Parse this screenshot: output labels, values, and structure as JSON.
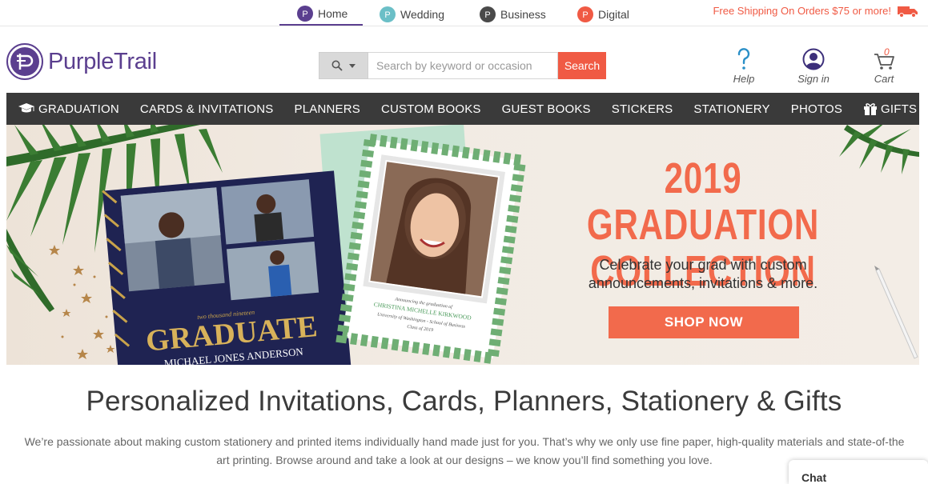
{
  "site_tabs": [
    {
      "label": "Home",
      "color": "#5b3f8f",
      "active": true
    },
    {
      "label": "Wedding",
      "color": "#6bbfc7",
      "active": false
    },
    {
      "label": "Business",
      "color": "#4a4a4a",
      "active": false
    },
    {
      "label": "Digital",
      "color": "#f05a44",
      "active": false
    }
  ],
  "shipping_text": "Free Shipping On Orders $75 or more!",
  "brand": {
    "name": "PurpleTrail",
    "color": "#5b3f8f",
    "accent": "#f05a44"
  },
  "search": {
    "placeholder": "Search by keyword or occasion",
    "value": "",
    "button_label": "Search"
  },
  "header_tools": {
    "help_label": "Help",
    "signin_label": "Sign in",
    "cart_label": "Cart",
    "cart_count": "0"
  },
  "categories": [
    {
      "label": "GRADUATION",
      "icon": "graduation-cap-icon"
    },
    {
      "label": "CARDS & INVITATIONS"
    },
    {
      "label": "PLANNERS"
    },
    {
      "label": "CUSTOM BOOKS"
    },
    {
      "label": "GUEST BOOKS"
    },
    {
      "label": "STICKERS"
    },
    {
      "label": "STATIONERY"
    },
    {
      "label": "PHOTOS"
    },
    {
      "label": "GIFTS",
      "icon": "gift-icon"
    }
  ],
  "hero": {
    "title_line1": "2019 GRADUATION",
    "title_line2": "COLLECTION",
    "subtitle": "Celebrate your grad with custom announcements, invitations & more.",
    "button_label": "SHOP NOW",
    "book": {
      "small_text": "two thousand nineteen",
      "big_text": "GRADUATE",
      "name": "MICHAEL JONES ANDERSON"
    },
    "card": {
      "line1": "Announcing the graduation of",
      "line2": "CHRISTINA MICHELLE KIRKWOOD",
      "line3": "University of Washington - School of Business",
      "line4": "Class of 2019"
    }
  },
  "headline": "Personalized Invitations, Cards, Planners, Stationery & Gifts",
  "intro": "We’re passionate about making custom stationery and printed items individually hand made just for you. That’s why we only use fine paper, high-quality materials and state-of-the art printing. Browse around and take a look at our designs – we know you’ll find something you love.",
  "chat_label": "Chat"
}
